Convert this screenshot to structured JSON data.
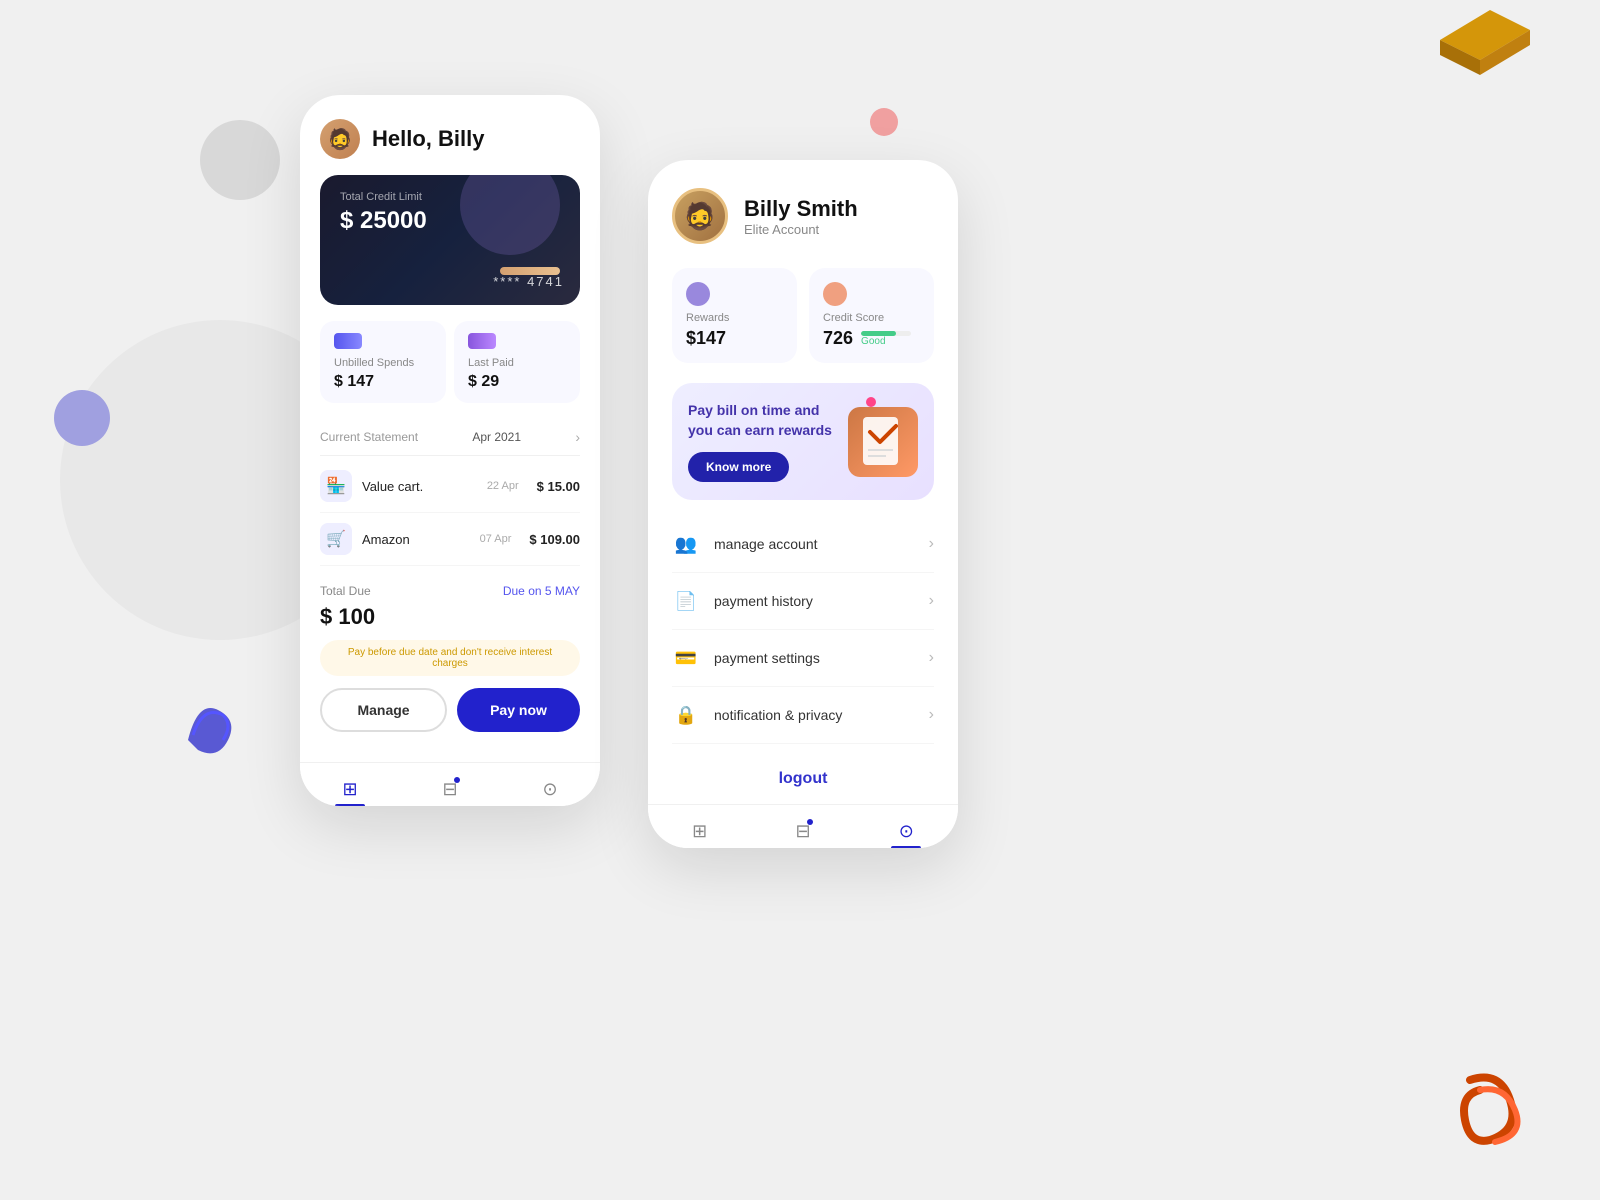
{
  "background": {
    "color": "#eeeeee"
  },
  "leftPhone": {
    "greeting": "Hello, Billy",
    "card": {
      "label": "Total Credit Limit",
      "amount": "$ 25000",
      "number": "**** 4741"
    },
    "stats": {
      "unbilledLabel": "Unbilled Spends",
      "unbilledAmount": "$ 147",
      "lastPaidLabel": "Last Paid",
      "lastPaidAmount": "$ 29"
    },
    "statement": {
      "label": "Current Statement",
      "date": "Apr 2021"
    },
    "transactions": [
      {
        "name": "Value cart.",
        "date": "22 Apr",
        "amount": "$ 15.00"
      },
      {
        "name": "Amazon",
        "date": "07 Apr",
        "amount": "$ 109.00"
      }
    ],
    "totalDue": {
      "label": "Total Due",
      "dueDate": "Due on 5 MAY",
      "amount": "$ 100",
      "warning": "Pay before due date and don't receive interest charges"
    },
    "buttons": {
      "manage": "Manage",
      "pay": "Pay now"
    },
    "nav": {
      "items": [
        "grid",
        "filter",
        "person"
      ]
    }
  },
  "rightPhone": {
    "profile": {
      "name": "Billy Smith",
      "badge": "Elite Account"
    },
    "rewards": {
      "label": "Rewards",
      "amount": "$147"
    },
    "creditScore": {
      "label": "Credit Score",
      "score": "726",
      "status": "Good"
    },
    "promo": {
      "text": "Pay bill on time and you can earn rewards",
      "buttonLabel": "Know more"
    },
    "menu": [
      {
        "id": "manage-account",
        "icon": "👥",
        "label": "manage account"
      },
      {
        "id": "payment-history",
        "icon": "📄",
        "label": "payment history"
      },
      {
        "id": "payment-settings",
        "icon": "💳",
        "label": "payment settings"
      },
      {
        "id": "notification-privacy",
        "icon": "🔒",
        "label": "notification & privacy"
      }
    ],
    "logout": "logout",
    "nav": {
      "items": [
        "grid",
        "filter",
        "person"
      ]
    }
  }
}
